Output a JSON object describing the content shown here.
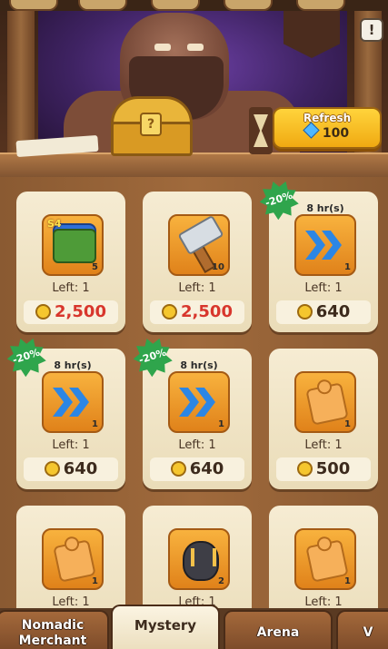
{
  "header": {
    "info_glyph": "!",
    "refresh": {
      "label": "Refresh",
      "cost": "100",
      "currency_icon": "gem-icon"
    }
  },
  "shop": {
    "items": [
      {
        "icon": "season-chest-icon",
        "badge_s": "S4",
        "qty": "5",
        "left": "Left: 1",
        "price": "2,500",
        "price_color": "red"
      },
      {
        "icon": "hammer-icon",
        "qty": "10",
        "left": "Left: 1",
        "price": "2,500",
        "price_color": "red"
      },
      {
        "icon": "speedup-icon",
        "discount": "-20%",
        "duration": "8 hr(s)",
        "qty": "1",
        "left": "Left: 1",
        "price": "640",
        "price_color": "dark"
      },
      {
        "icon": "speedup-icon",
        "discount": "-20%",
        "duration": "8 hr(s)",
        "qty": "1",
        "left": "Left: 1",
        "price": "640",
        "price_color": "dark"
      },
      {
        "icon": "speedup-icon",
        "discount": "-20%",
        "duration": "8 hr(s)",
        "qty": "1",
        "left": "Left: 1",
        "price": "640",
        "price_color": "dark"
      },
      {
        "icon": "puzzle-piece-icon",
        "qty": "1",
        "left": "Left: 1",
        "price": "500",
        "price_color": "dark"
      },
      {
        "icon": "puzzle-piece-icon",
        "qty": "1",
        "left": "Left: 1"
      },
      {
        "icon": "claw-stone-icon",
        "qty": "2",
        "left": "Left: 1"
      },
      {
        "icon": "puzzle-piece-icon",
        "qty": "1",
        "left": "Left: 1"
      }
    ]
  },
  "tabs": [
    {
      "label": "Nomadic Merchant",
      "line1": "Nomadic",
      "line2": "Merchant",
      "active": false
    },
    {
      "label": "Mystery",
      "line1": "Mystery",
      "active": true
    },
    {
      "label": "Arena",
      "line1": "Arena",
      "active": false
    },
    {
      "label": "V",
      "line1": "V",
      "active": false
    }
  ],
  "colors": {
    "price_red": "#d8362d",
    "price_dark": "#3d2b1d",
    "discount_green": "#2fa54c",
    "refresh_gold": "#f0a912"
  }
}
